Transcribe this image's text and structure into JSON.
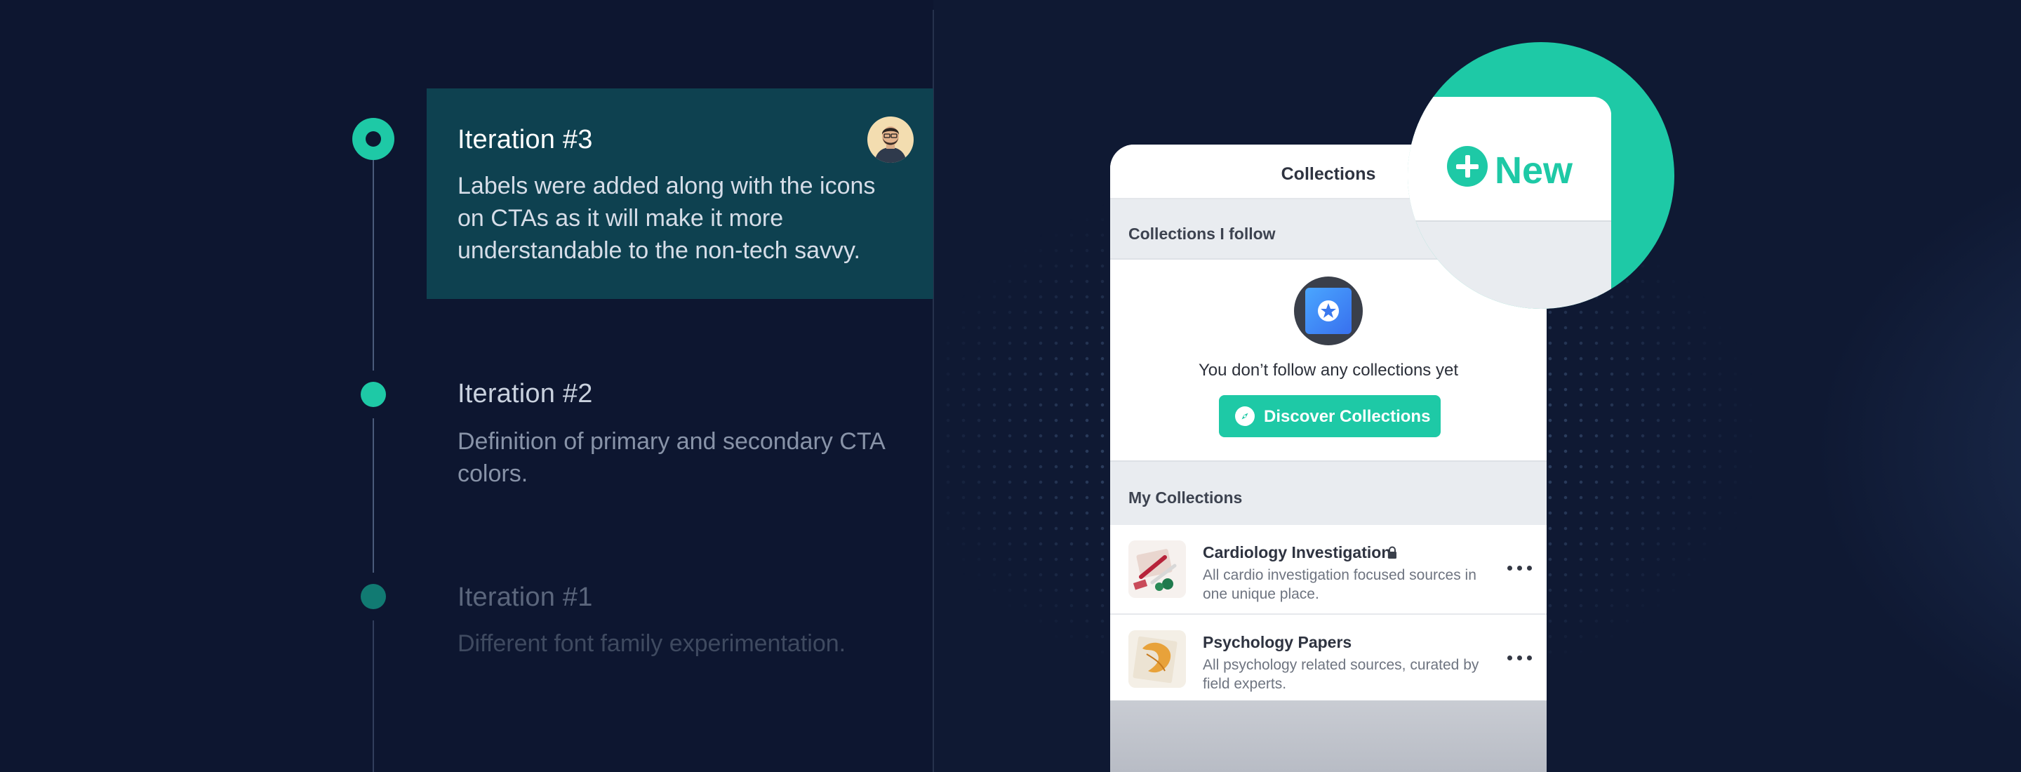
{
  "timeline": {
    "iterations": [
      {
        "title": "Iteration #3",
        "description": "Labels were added along with the icons on CTAs as it will make it more understandable to the non-tech savvy."
      },
      {
        "title": "Iteration #2",
        "description": "Definition of primary and secondary CTA colors."
      },
      {
        "title": "Iteration #1",
        "description": "Different font family experimentation."
      }
    ]
  },
  "phone": {
    "title": "Collections",
    "follow_section": {
      "header": "Collections I follow",
      "empty_text": "You don’t follow any collections yet",
      "discover_button": "Discover Collections"
    },
    "my_section": {
      "header": "My Collections",
      "items": [
        {
          "title": "Cardiology Investigation",
          "description": "All cardio investigation focused sources in one unique place.",
          "locked": true
        },
        {
          "title": "Psychology Papers",
          "description": "All psychology related sources, curated by field experts.",
          "locked": false
        }
      ]
    },
    "new_button": "New"
  },
  "colors": {
    "accent": "#1ec9a6",
    "background": "#0e1730",
    "active_card": "#0e4150"
  }
}
